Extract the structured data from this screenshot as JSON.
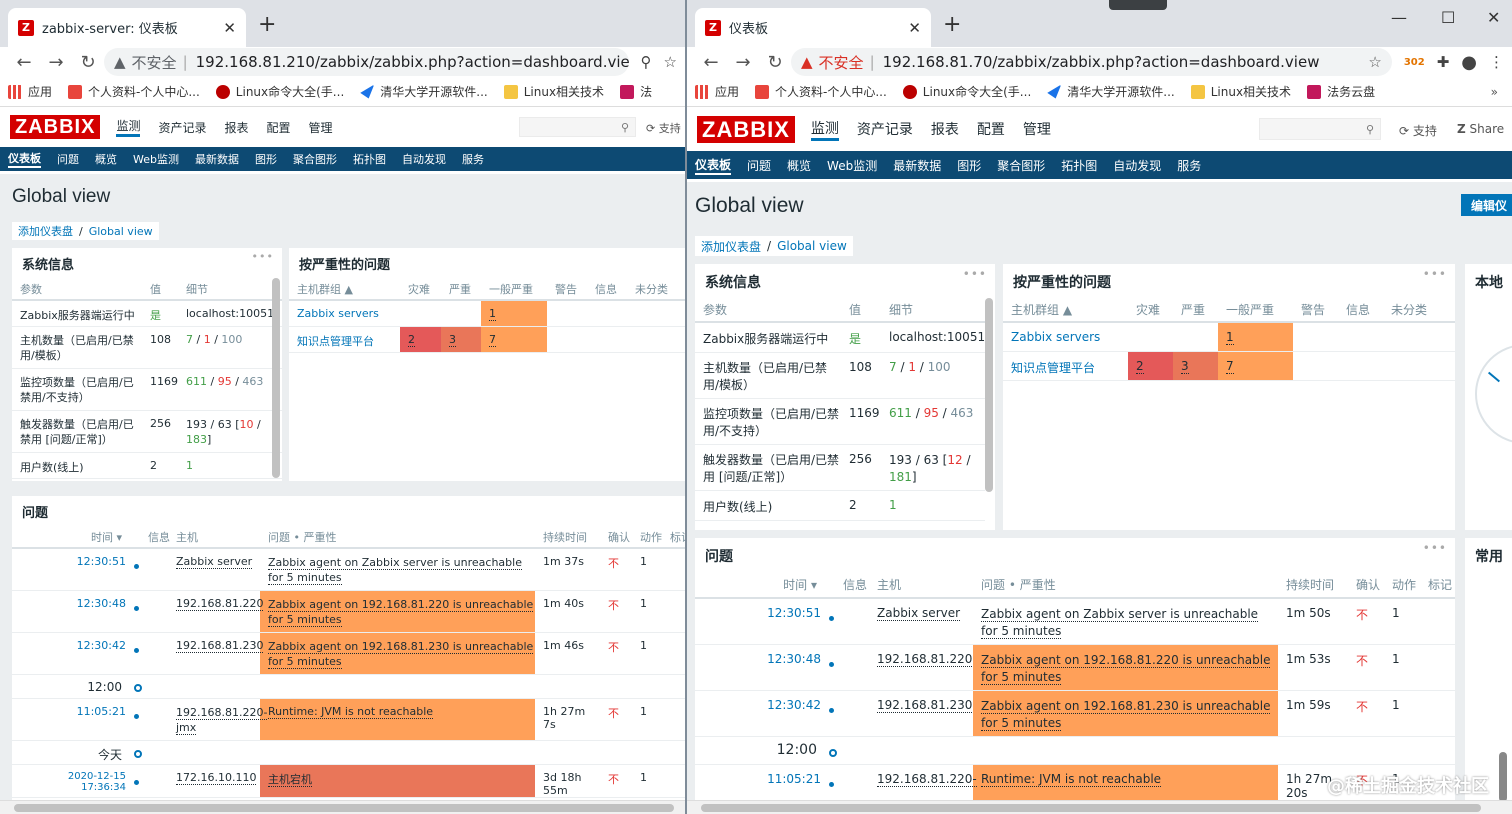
{
  "left": {
    "tab_title": "zabbix-server: 仪表板",
    "insecure": "不安全",
    "url": "192.168.81.210/zabbix/zabbix.php?action=dashboard.view&...",
    "bookmarks": [
      "应用",
      "个人资料-个人中心...",
      "Linux命令大全(手...",
      "清华大学开源软件...",
      "Linux相关技术",
      "法"
    ],
    "logo": "ZABBIX",
    "menu": [
      "监测",
      "资产记录",
      "报表",
      "配置",
      "管理"
    ],
    "support": "支持",
    "subnav": [
      "仪表板",
      "问题",
      "概览",
      "Web监测",
      "最新数据",
      "图形",
      "聚合图形",
      "拓扑图",
      "自动发现",
      "服务"
    ],
    "page_title": "Global view",
    "crumb_root": "添加仪表盘",
    "crumb_cur": "Global view",
    "sysinfo": {
      "title": "系统信息",
      "h_param": "参数",
      "h_value": "值",
      "h_detail": "细节",
      "r1_p": "Zabbix服务器端运行中",
      "r1_v": "是",
      "r1_d": "localhost:10051",
      "r2_p": "主机数量（已启用/已禁用/模板）",
      "r2_v": "108",
      "r2_d1": "7",
      "r2_d2": "1",
      "r2_d3": "100",
      "r3_p": "监控项数量（已启用/已禁用/不支持）",
      "r3_v": "1169",
      "r3_d1": "611",
      "r3_d2": "95",
      "r3_d3": "463",
      "r4_p": "触发器数量（已启用/已禁用 [问题/正常]）",
      "r4_v": "256",
      "r4_d1": "193 / 63 [",
      "r4_d2": "10",
      "r4_d3": " / ",
      "r4_d4": "183",
      "r4_d5": "]",
      "r5_p": "用户数(线上)",
      "r5_v": "2",
      "r5_d": "1"
    },
    "sev": {
      "title": "按严重性的问题",
      "h_group": "主机群组 ▲",
      "h": [
        "灾难",
        "严重",
        "一般严重",
        "警告",
        "信息",
        "未分类"
      ],
      "g1": "Zabbix servers",
      "g1_avg": "1",
      "g2": "知识点管理平台",
      "g2_dis": "2",
      "g2_high": "3",
      "g2_avg": "7"
    },
    "problems": {
      "title": "问题",
      "h_time": "时间 ▾",
      "h_info": "信息",
      "h_host": "主机",
      "h_problem": "问题 • 严重性",
      "h_dur": "持续时间",
      "h_ack": "确认",
      "h_act": "动作",
      "h_tag": "标记",
      "rows": [
        {
          "time": "12:30:51",
          "host": "Zabbix server",
          "problem": "Zabbix agent on Zabbix server is unreachable for 5 minutes",
          "dur": "1m 37s",
          "ack": "不",
          "act": "1"
        },
        {
          "time": "12:30:48",
          "host": "192.168.81.220",
          "problem": "Zabbix agent on 192.168.81.220 is unreachable for 5 minutes",
          "dur": "1m 40s",
          "ack": "不",
          "act": "1"
        },
        {
          "time": "12:30:42",
          "host": "192.168.81.230",
          "problem": "Zabbix agent on 192.168.81.230 is unreachable for 5 minutes",
          "dur": "1m 46s",
          "ack": "不",
          "act": "1"
        },
        {
          "time": "11:05:21",
          "host": "192.168.81.220-jmx",
          "problem": "Runtime: JVM is not reachable",
          "dur": "1h 27m 7s",
          "ack": "不",
          "act": "1"
        },
        {
          "time": "2020-12-15 17:36:34",
          "host": "172.16.10.110",
          "problem": "主机宕机",
          "dur": "3d 18h 55m",
          "ack": "不",
          "act": "1"
        }
      ],
      "mark_1200": "12:00",
      "mark_today": "今天"
    }
  },
  "right": {
    "tab_title": "仪表板",
    "insecure": "不安全",
    "url": "192.168.81.70/zabbix/zabbix.php?action=dashboard.view",
    "ext_badge": "302",
    "bookmarks": [
      "应用",
      "个人资料-个人中心...",
      "Linux命令大全(手...",
      "清华大学开源软件...",
      "Linux相关技术",
      "法务云盘"
    ],
    "logo": "ZABBIX",
    "menu": [
      "监测",
      "资产记录",
      "报表",
      "配置",
      "管理"
    ],
    "support": "支持",
    "share": "Share",
    "subnav": [
      "仪表板",
      "问题",
      "概览",
      "Web监测",
      "最新数据",
      "图形",
      "聚合图形",
      "拓扑图",
      "自动发现",
      "服务"
    ],
    "page_title": "Global view",
    "edit_btn": "编辑仪",
    "crumb_root": "添加仪表盘",
    "crumb_cur": "Global view",
    "sysinfo": {
      "title": "系统信息",
      "h_param": "参数",
      "h_value": "值",
      "h_detail": "细节",
      "r1_p": "Zabbix服务器端运行中",
      "r1_v": "是",
      "r1_d": "localhost:10051",
      "r2_p": "主机数量（已启用/已禁用/模板）",
      "r2_v": "108",
      "r2_d1": "7",
      "r2_d2": "1",
      "r2_d3": "100",
      "r3_p": "监控项数量（已启用/已禁用/不支持）",
      "r3_v": "1169",
      "r3_d1": "611",
      "r3_d2": "95",
      "r3_d3": "463",
      "r4_p": "触发器数量（已启用/已禁用 [问题/正常]）",
      "r4_v": "256",
      "r4_d1": "193 / 63 [",
      "r4_d2": "12",
      "r4_d3": " / ",
      "r4_d4": "181",
      "r4_d5": "]",
      "r5_p": "用户数(线上)",
      "r5_v": "2",
      "r5_d": "1"
    },
    "sev": {
      "title": "按严重性的问题",
      "h_group": "主机群组 ▲",
      "h": [
        "灾难",
        "严重",
        "一般严重",
        "警告",
        "信息",
        "未分类"
      ],
      "g1": "Zabbix servers",
      "g1_avg": "1",
      "g2": "知识点管理平台",
      "g2_dis": "2",
      "g2_high": "3",
      "g2_avg": "7"
    },
    "local_title": "本地",
    "common_title": "常用",
    "problems": {
      "title": "问题",
      "h_time": "时间 ▾",
      "h_info": "信息",
      "h_host": "主机",
      "h_problem": "问题 • 严重性",
      "h_dur": "持续时间",
      "h_ack": "确认",
      "h_act": "动作",
      "h_tag": "标记",
      "rows": [
        {
          "time": "12:30:51",
          "host": "Zabbix server",
          "problem": "Zabbix agent on Zabbix server is unreachable for 5 minutes",
          "dur": "1m 50s",
          "ack": "不",
          "act": "1"
        },
        {
          "time": "12:30:48",
          "host": "192.168.81.220",
          "problem": "Zabbix agent on 192.168.81.220 is unreachable for 5 minutes",
          "dur": "1m 53s",
          "ack": "不",
          "act": "1"
        },
        {
          "time": "12:30:42",
          "host": "192.168.81.230",
          "problem": "Zabbix agent on 192.168.81.230 is unreachable for 5 minutes",
          "dur": "1m 59s",
          "ack": "不",
          "act": "1"
        },
        {
          "time": "11:05:21",
          "host": "192.168.81.220-",
          "problem": "Runtime: JVM is not reachable",
          "dur": "1h 27m 20s",
          "ack": "不",
          "act": "1"
        }
      ],
      "mark_1200": "12:00"
    },
    "watermark": "@稀土掘金技术社区"
  },
  "colors": {
    "zabbix_red": "#d40000",
    "subnav_blue": "#0d4a73",
    "link_blue": "#0275b8",
    "avg_orange": "#ffa059",
    "disaster_red": "#e45959",
    "high_red": "#e97659"
  }
}
